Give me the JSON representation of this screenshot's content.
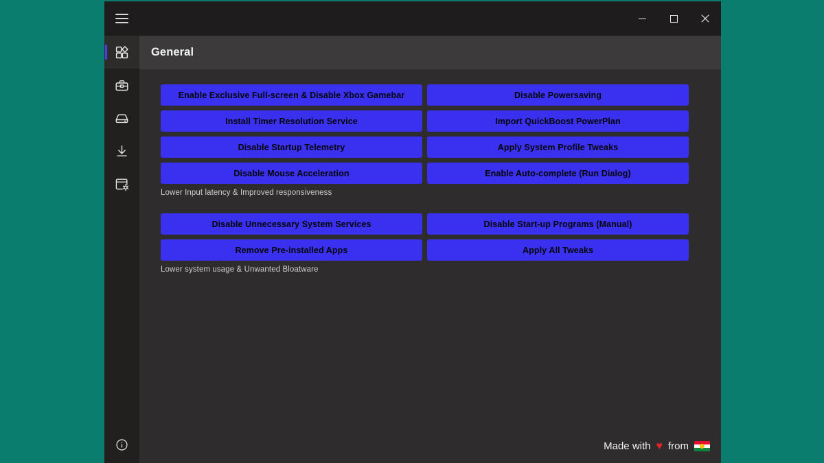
{
  "window": {
    "background_color": "#0b7d6e",
    "titlebar": {
      "menu_icon": "hamburger-icon",
      "minimize_label": "─",
      "maximize_label": "□",
      "close_label": "✕"
    }
  },
  "sidebar": {
    "items": [
      {
        "id": "general",
        "icon": "dashboard-widgets-icon",
        "active": true
      },
      {
        "id": "tools",
        "icon": "toolbox-icon",
        "active": false
      },
      {
        "id": "storage",
        "icon": "hard-drive-icon",
        "active": false
      },
      {
        "id": "downloads",
        "icon": "download-icon",
        "active": false
      },
      {
        "id": "app-manager",
        "icon": "window-gear-icon",
        "active": false
      }
    ],
    "info": {
      "icon": "info-circle-icon"
    },
    "active_indicator_color": "#4a3df0"
  },
  "header": {
    "title": "General"
  },
  "main": {
    "accent_color": "#3a31f0",
    "groups": [
      {
        "id": "performance",
        "buttons": [
          "Enable Exclusive Full-screen & Disable Xbox Gamebar",
          "Disable Powersaving",
          "Install Timer Resolution Service",
          "Import QuickBoost PowerPlan",
          "Disable Startup Telemetry",
          "Apply System Profile Tweaks",
          "Disable Mouse Acceleration",
          "Enable Auto-complete (Run Dialog)"
        ],
        "caption": "Lower Input latency & Improved responsiveness"
      },
      {
        "id": "bloatware",
        "buttons": [
          "Disable Unnecessary System Services",
          "Disable Start-up Programs (Manual)",
          "Remove Pre-installed Apps",
          "Apply All Tweaks"
        ],
        "caption": "Lower system usage & Unwanted Bloatware"
      }
    ]
  },
  "footer": {
    "prefix": "Made with",
    "heart": "♥",
    "middle": "from",
    "flag": "kurdistan-flag-icon"
  }
}
